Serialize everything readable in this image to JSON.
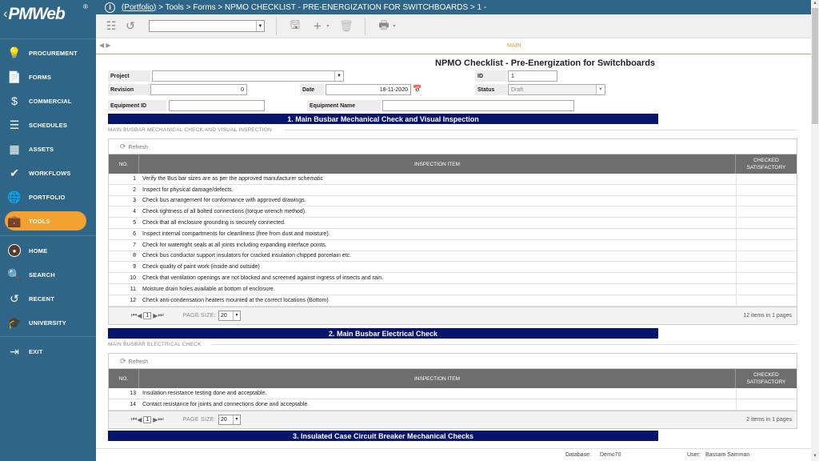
{
  "app": {
    "logo": "PMWeb",
    "registered": "®"
  },
  "sidebar": {
    "items": [
      {
        "label": "PROCUREMENT",
        "icon": "procurement-icon",
        "glyph": "💡"
      },
      {
        "label": "FORMS",
        "icon": "forms-icon",
        "glyph": "📄"
      },
      {
        "label": "COMMERCIAL",
        "icon": "dollar-icon",
        "glyph": "$"
      },
      {
        "label": "SCHEDULES",
        "icon": "schedules-icon",
        "glyph": "☰"
      },
      {
        "label": "ASSETS",
        "icon": "assets-icon",
        "glyph": "▦"
      },
      {
        "label": "WORKFLOWS",
        "icon": "checkmark-icon",
        "glyph": "✔"
      },
      {
        "label": "PORTFOLIO",
        "icon": "globe-icon",
        "glyph": "🌐"
      },
      {
        "label": "TOOLS",
        "icon": "briefcase-icon",
        "glyph": "💼"
      }
    ],
    "bottom_items": [
      {
        "label": "HOME",
        "icon": "avatar-icon",
        "glyph": "●"
      },
      {
        "label": "SEARCH",
        "icon": "search-icon",
        "glyph": "🔍"
      },
      {
        "label": "RECENT",
        "icon": "history-icon",
        "glyph": "↺"
      },
      {
        "label": "UNIVERSITY",
        "icon": "graduation-cap-icon",
        "glyph": "🎓"
      }
    ],
    "exit": {
      "label": "EXIT",
      "icon": "exit-icon",
      "glyph": "⇥"
    }
  },
  "breadcrumb": {
    "link": "(Portfolio)",
    "rest": " > Tools > Forms > NPMO CHECKLIST - PRE-ENERGIZATION FOR SWITCHBOARDS > 1 -"
  },
  "tabs": {
    "main": "MAIN"
  },
  "form": {
    "title": "NPMO Checklist - Pre-Energization for Switchboards",
    "project_label": "Project",
    "project_value": "",
    "id_label": "ID",
    "id_value": "1",
    "revision_label": "Revision",
    "revision_value": "0",
    "date_label": "Date",
    "date_value": "18-11-2020",
    "status_label": "Status",
    "status_value": "Draft",
    "equipment_id_label": "Equipment ID",
    "equipment_id_value": "",
    "equipment_name_label": "Equipment Name",
    "equipment_name_value": ""
  },
  "sections": [
    {
      "title": "1. Main Busbar Mechanical Check and Visual Inspection",
      "subtitle": "MAIN BUSBAR MECHANICAL CHECK AND VISUAL INSPECTION",
      "refresh": "Refresh",
      "columns": [
        "NO.",
        "INSPECTION ITEM",
        "CHECKED\nSATISFACTORY"
      ],
      "rows": [
        {
          "no": "1",
          "item": "Verify the Bus bar sizes are as per the approved manufacturer schematic"
        },
        {
          "no": "2",
          "item": "Inspect for physical damage/defects."
        },
        {
          "no": "3",
          "item": "Check bus arrangement for conformance with approved drawings."
        },
        {
          "no": "4",
          "item": "Check tightness of all bolted connections (torque wrench method)."
        },
        {
          "no": "5",
          "item": "Check that all enclosure grounding is securely connected."
        },
        {
          "no": "6",
          "item": "Inspect internal compartments for cleanliness (free from dust and moisture)."
        },
        {
          "no": "7",
          "item": "Check for watertight seals at all joints including expanding interface points."
        },
        {
          "no": "8",
          "item": "Check bus conductor support insulators for cracked insulation chipped porcelain etc."
        },
        {
          "no": "9",
          "item": "Check quality of paint work (inside and outside)"
        },
        {
          "no": "10",
          "item": "Check that ventilation openings are not blocked and screened against ingress of insects and rain."
        },
        {
          "no": "11",
          "item": "Moisture drain holes available at bottom of enclosure."
        },
        {
          "no": "12",
          "item": "Check anti-condensation heaters mounted at the correct locations (Bottom)"
        }
      ],
      "pager": {
        "page": "1",
        "page_size_label": "PAGE SIZE:",
        "page_size": "20",
        "info": "12 items in 1 pages"
      }
    },
    {
      "title": "2. Main Busbar Electrical Check",
      "subtitle": "MAIN BUSBAR ELECTRICAL CHECK",
      "refresh": "Refresh",
      "columns": [
        "NO.",
        "INSPECTION ITEM",
        "CHECKED\nSATISFACTORY"
      ],
      "rows": [
        {
          "no": "13",
          "item": "Insulation resistance testing done and acceptable."
        },
        {
          "no": "14",
          "item": "Contact resistance for joints and connections done and acceptable."
        }
      ],
      "pager": {
        "page": "1",
        "page_size_label": "PAGE SIZE:",
        "page_size": "20",
        "info": "2 items in 1 pages"
      }
    },
    {
      "title": "3. Insulated Case Circuit Breaker Mechanical Checks"
    }
  ],
  "status": {
    "database_label": "Database:",
    "database": "Demo70",
    "user_label": "User:",
    "user": "Bassam Samman"
  }
}
